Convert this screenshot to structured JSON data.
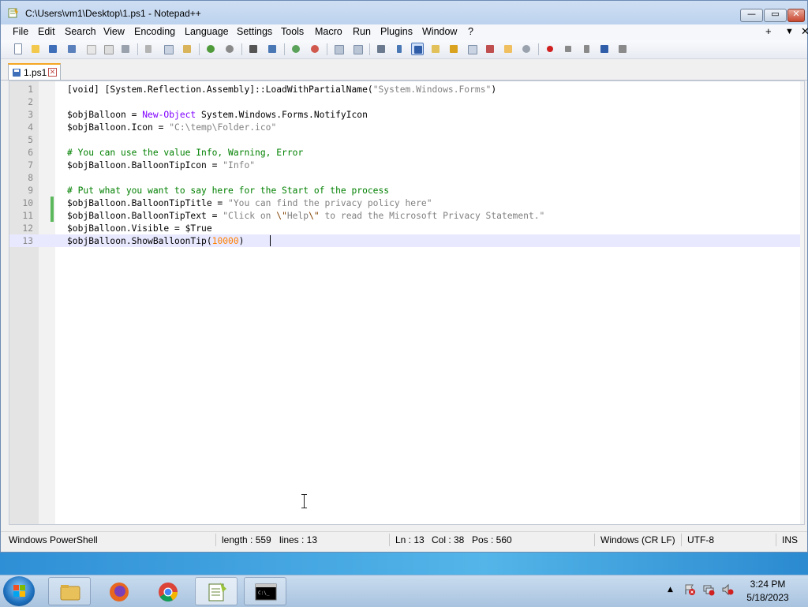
{
  "window": {
    "title": "C:\\Users\\vm1\\Desktop\\1.ps1 - Notepad++",
    "minimize_glyph": "—",
    "maximize_glyph": "▭",
    "close_glyph": "✕"
  },
  "menu": {
    "items": [
      "File",
      "Edit",
      "Search",
      "View",
      "Encoding",
      "Language",
      "Settings",
      "Tools",
      "Macro",
      "Run",
      "Plugins",
      "Window",
      "?"
    ],
    "right": [
      "+",
      "▼",
      "✕"
    ]
  },
  "tab": {
    "label": "1.ps1",
    "close": "✕"
  },
  "editor": {
    "lines": [
      {
        "n": "1",
        "html": "[void] [System.Reflection.Assembly]::LoadWithPartialName(<span class=\"t-str\">\"System.Windows.Forms\"</span>)"
      },
      {
        "n": "2",
        "html": ""
      },
      {
        "n": "3",
        "html": "$objBalloon = <span class=\"t-cmd\">New-Object</span> System.Windows.Forms.NotifyIcon"
      },
      {
        "n": "4",
        "html": "$objBalloon.Icon = <span class=\"t-str\">\"C:\\temp\\Folder.ico\"</span>"
      },
      {
        "n": "5",
        "html": ""
      },
      {
        "n": "6",
        "html": "<span class=\"t-cmt\"># You can use the value Info, Warning, Error</span>"
      },
      {
        "n": "7",
        "html": "$objBalloon.BalloonTipIcon = <span class=\"t-str\">\"Info\"</span>"
      },
      {
        "n": "8",
        "html": ""
      },
      {
        "n": "9",
        "html": "<span class=\"t-cmt\"># Put what you want to say here for the Start of the process</span>"
      },
      {
        "n": "10",
        "html": "$objBalloon.BalloonTipTitle = <span class=\"t-str\">\"You can find the privacy policy here\"</span>"
      },
      {
        "n": "11",
        "html": "$objBalloon.BalloonTipText = <span class=\"t-str\">\"Click on </span><span class=\"t-esc\">\\\"</span><span class=\"t-str\">Help</span><span class=\"t-esc\">\\\"</span><span class=\"t-str\"> to read the Microsoft Privacy Statement.\"</span>"
      },
      {
        "n": "12",
        "html": "$objBalloon.Visible = $True"
      },
      {
        "n": "13",
        "html": "$objBalloon.ShowBalloonTip(<span class=\"t-num\">10000</span>)"
      }
    ],
    "current_line": 13,
    "changed_lines": [
      10,
      11
    ]
  },
  "status": {
    "language": "Windows PowerShell",
    "length": "length : 559",
    "lines": "lines : 13",
    "ln": "Ln : 13",
    "col": "Col : 38",
    "pos": "Pos : 560",
    "eol": "Windows (CR LF)",
    "encoding": "UTF-8",
    "mode": "INS"
  },
  "taskbar": {
    "apps": [
      "file-explorer",
      "firefox",
      "chrome",
      "notepad-plus-plus",
      "command-prompt"
    ],
    "time": "3:24 PM",
    "date": "5/18/2023"
  },
  "colors": {
    "string": "#808080",
    "command": "#8000ff",
    "comment": "#008000",
    "number": "#ff8000",
    "current_line": "#e8e8ff",
    "change_marker": "#5cb85c"
  }
}
